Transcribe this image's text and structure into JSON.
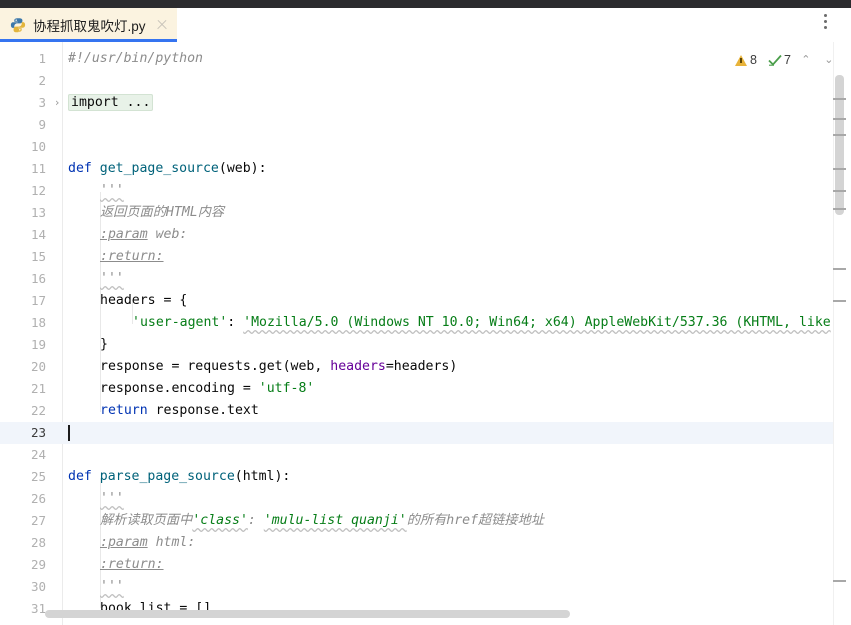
{
  "window": {
    "title_strip_color": "#2b2b2e"
  },
  "tab": {
    "label": "协程抓取鬼吹灯.py",
    "icon": "python-file-icon",
    "close_icon": "close-icon",
    "active_underline_color": "#3574f0",
    "background_color": "#fbf3e0"
  },
  "toolbar": {
    "more_menu_icon": "kebab-menu-icon"
  },
  "inspection": {
    "warning_icon": "warning-triangle-icon",
    "warning_count": "8",
    "ok_icon": "inspection-check-icon",
    "ok_count": "7",
    "prev_icon": "chevron-up-icon",
    "prev_glyph": "⌃",
    "next_icon": "chevron-down-icon",
    "next_glyph": "⌄"
  },
  "editor": {
    "fold_chevron_glyph": "›",
    "caret_line": 23,
    "lines": [
      {
        "n": "1",
        "indent": 0
      },
      {
        "n": "2",
        "indent": 0
      },
      {
        "n": "3",
        "indent": 0
      },
      {
        "n": "9",
        "indent": 0
      },
      {
        "n": "10",
        "indent": 0
      },
      {
        "n": "11",
        "indent": 0
      },
      {
        "n": "12",
        "indent": 0
      },
      {
        "n": "13",
        "indent": 0
      },
      {
        "n": "14",
        "indent": 0
      },
      {
        "n": "15",
        "indent": 0
      },
      {
        "n": "16",
        "indent": 0
      },
      {
        "n": "17",
        "indent": 0
      },
      {
        "n": "18",
        "indent": 0
      },
      {
        "n": "19",
        "indent": 0
      },
      {
        "n": "20",
        "indent": 0
      },
      {
        "n": "21",
        "indent": 0
      },
      {
        "n": "22",
        "indent": 0
      },
      {
        "n": "23",
        "indent": 0
      },
      {
        "n": "24",
        "indent": 0
      },
      {
        "n": "25",
        "indent": 0
      },
      {
        "n": "26",
        "indent": 0
      },
      {
        "n": "27",
        "indent": 0
      },
      {
        "n": "28",
        "indent": 0
      },
      {
        "n": "29",
        "indent": 0
      },
      {
        "n": "30",
        "indent": 0
      },
      {
        "n": "31",
        "indent": 0
      }
    ],
    "code_text": {
      "l1": "#!/usr/bin/python",
      "l3_folded": "import ...",
      "l11_kw": "def",
      "l11_fn": "get_page_source",
      "l11_rest": "(web):",
      "l12_quotes": "'''",
      "l13_doc": "返回页面的HTML内容",
      "l14_tag": ":param",
      "l14_rest": " web:",
      "l15_tag": ":return:",
      "l16_quotes": "'''",
      "l17": "headers = {",
      "l18_key": "'user-agent'",
      "l18_colon": ": ",
      "l18_val": "'Mozilla/5.0 (Windows NT 10.0; Win64; x64) AppleWebKit/537.36 (KHTML, like",
      "l19": "}",
      "l20_a": "response = requests.get(web, ",
      "l20_kwarg": "headers",
      "l20_b": "=headers)",
      "l21_a": "response.encoding = ",
      "l21_str": "'utf-8'",
      "l22_kw": "return",
      "l22_rest": " response.text",
      "l25_kw": "def",
      "l25_fn": "parse_page_source",
      "l25_rest": "(html):",
      "l26_quotes": "'''",
      "l27_a": "解析读取页面中",
      "l27_s1": "'class'",
      "l27_b": ": ",
      "l27_s2": "'mulu-list quanji'",
      "l27_c": "的所有href超链接地址",
      "l28_tag": ":param",
      "l28_rest": " html:",
      "l29_tag": ":return:",
      "l30_quotes": "'''",
      "l31": "book_list = []"
    },
    "colors": {
      "keyword": "#0033b3",
      "function": "#00627a",
      "string": "#067d17",
      "comment": "#8c8c8c",
      "named_arg": "#660099",
      "caret_line_bg": "#f1f5fb",
      "folded_bg": "#e8f2e8"
    }
  },
  "scrollbars": {
    "vertical_thumb": "vertical-scrollbar-thumb",
    "horizontal_thumb": "horizontal-scrollbar-thumb"
  }
}
